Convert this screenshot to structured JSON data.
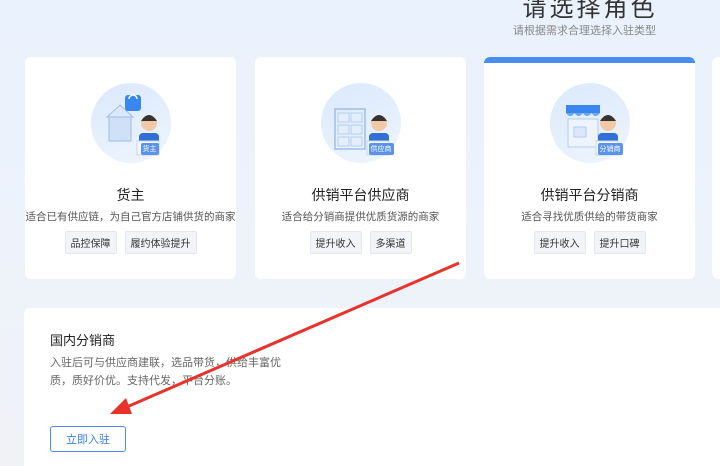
{
  "header": {
    "title": "请选择角色",
    "subtitle": "请根据需求合理选择入驻类型"
  },
  "roles": [
    {
      "name": "货主",
      "badge": "货主",
      "desc": "适合已有供应链，为自己官方店铺供货的商家",
      "tags": [
        "品控保障",
        "履约体验提升"
      ],
      "icon": "shop-bag-icon"
    },
    {
      "name": "供销平台供应商",
      "badge": "供应商",
      "desc": "适合给分销商提供优质货源的商家",
      "tags": [
        "提升收入",
        "多渠道"
      ],
      "icon": "warehouse-boxes-icon"
    },
    {
      "name": "供销平台分销商",
      "badge": "分销商",
      "desc": "适合寻找优质供给的带货商家",
      "tags": [
        "提升收入",
        "提升口碑"
      ],
      "icon": "storefront-icon",
      "selected": true
    }
  ],
  "detail": {
    "title": "国内分销商",
    "description": "入驻后可与供应商建联，选品带货，供给丰富优质，质好价优。支持代发，平台分账。",
    "button_label": "立即入驻"
  },
  "colors": {
    "accent": "#4a8df0",
    "annotation_arrow": "#e8322c"
  }
}
